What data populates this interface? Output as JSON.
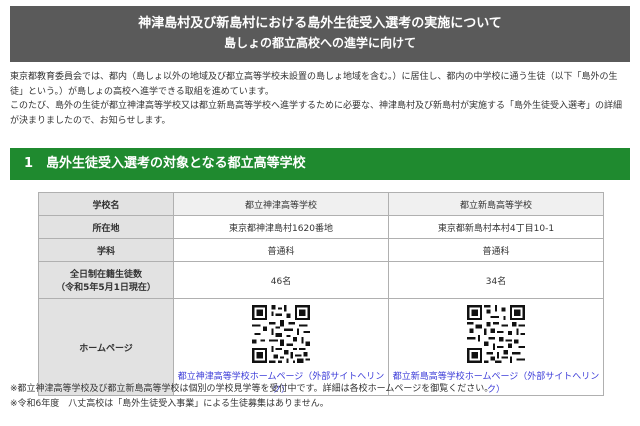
{
  "header": {
    "title": "神津島村及び新島村における島外生徒受入選考の実施について",
    "subtitle": "島しょの都立高校への進学に向けて"
  },
  "intro": {
    "line1": "東京都教育委員会では、都内（島しょ以外の地域及び都立高等学校未設置の島しょ地域を含む。）に居住し、都内の中学校に通う生徒（以下「島外の生",
    "line2": "徒」という。）が島しょの高校へ進学できる取組を進めています。",
    "line3": "このたび、島外の生徒が都立神津高等学校又は都立新島高等学校へ進学するために必要な、神津島村及び新島村が実施する「島外生徒受入選考」の詳細",
    "line4": "が決まりましたので、お知らせします。"
  },
  "section": {
    "title": "1　島外生徒受入選考の対象となる都立高等学校"
  },
  "table": {
    "headers": {
      "school_name": "学校名",
      "location": "所在地",
      "course": "学科",
      "students": "全日制在籍生徒数",
      "students_note": "（令和5年5月1日現在）",
      "homepage": "ホームページ"
    },
    "schools": [
      {
        "name": "都立神津高等学校",
        "address": "東京都神津島村1620番地",
        "course": "普通科",
        "students": "46名",
        "link": "都立神津高等学校ホームページ（外部サイトへリンク）"
      },
      {
        "name": "都立新島高等学校",
        "address": "東京都新島村本村4丁目10-1",
        "course": "普通科",
        "students": "34名",
        "link": "都立新島高等学校ホームページ（外部サイトへリンク）"
      }
    ]
  },
  "notes": {
    "note1": "※都立神津高等学校及び都立新島高等学校は個別の学校見学等を受付中です。詳細は各校ホームページを御覧ください。",
    "note2": "※令和6年度　八丈高校は「島外生徒受入事業」による生徒募集はありません。"
  },
  "colors": {
    "header_bg": "#5a5a5a",
    "section_bg": "#1f8a2f",
    "link": "#3b3bd8",
    "row_header_bg": "#e2e2e2"
  },
  "icons": {
    "qr1": "qr-code-icon",
    "qr2": "qr-code-icon"
  }
}
